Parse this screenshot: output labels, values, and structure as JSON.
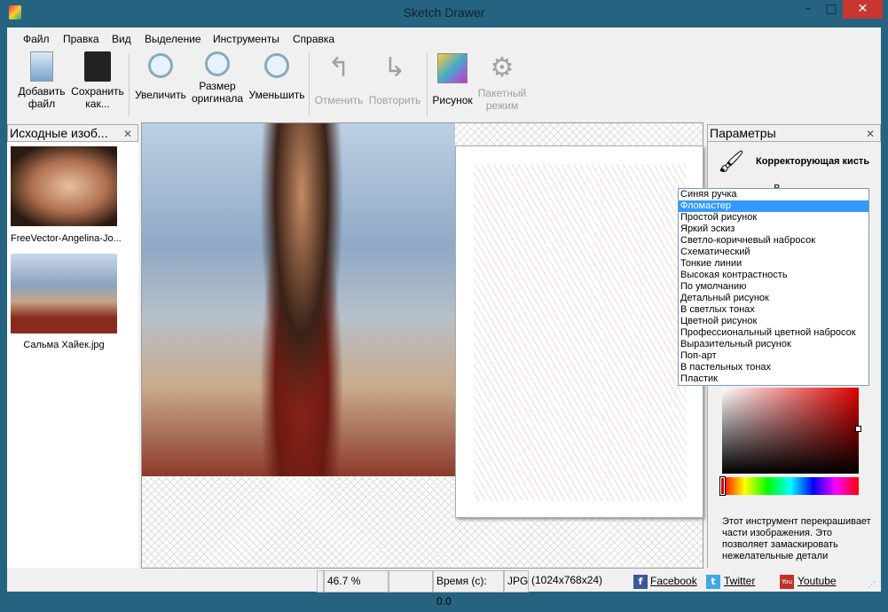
{
  "window": {
    "title": "Sketch Drawer"
  },
  "menu": [
    "Файл",
    "Правка",
    "Вид",
    "Выделение",
    "Инструменты",
    "Справка"
  ],
  "toolbar": {
    "add_file": "Добавить файл",
    "save_as": "Сохранить как...",
    "zoom_in": "Увеличить",
    "original_size": "Размер оригинала",
    "zoom_out": "Уменьшить",
    "undo": "Отменить",
    "redo": "Повторить",
    "drawing": "Рисунок",
    "batch": "Пакетный режим"
  },
  "left_panel": {
    "title": "Исходные изоб...",
    "files": [
      "FreeVector-Angelina-Jo...",
      "Сальма Хайек.jpg"
    ]
  },
  "right_panel": {
    "title": "Параметры",
    "tool_name": "Корректорующая кисть",
    "tool_partial": "В",
    "description": "Этот инструмент перекрашивает части изображения. Это позволяет замаскировать нежелательные детали"
  },
  "style_dropdown": {
    "selected": "Фломастер",
    "options": [
      "Синяя ручка",
      "Фломастер",
      "Простой рисунок",
      "Яркий эскиз",
      "Светло-коричневый набросок",
      "Схематический",
      "Тонкие линии",
      "Высокая контрастность",
      "По умолчанию",
      "Детальный рисунок",
      "В светлых тонах",
      "Цветной рисунок",
      "Профессиональный цветной набросок",
      "Выразительный рисунок",
      "Поп-арт",
      "В пастельных тонах",
      "Пластик"
    ]
  },
  "color": {
    "selected": "#cc0000"
  },
  "status": {
    "zoom": "46.7 %",
    "time": "Время (с): 0.0",
    "format": "JPG",
    "dimensions": "(1024x768x24)",
    "facebook": "Facebook",
    "twitter": "Twitter",
    "youtube": "Youtube"
  }
}
